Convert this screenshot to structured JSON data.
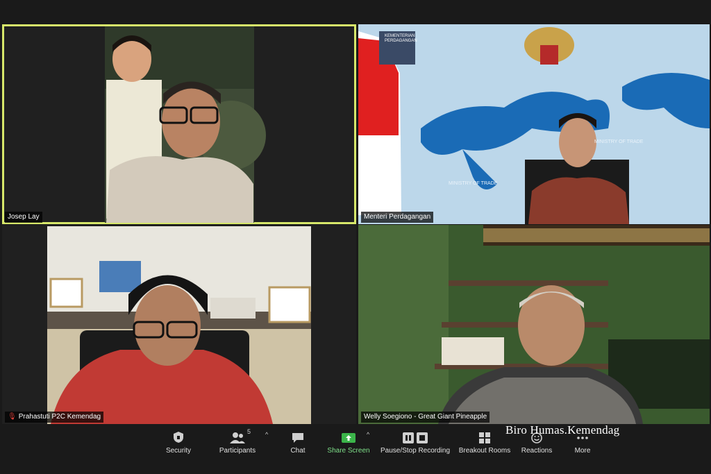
{
  "participants": [
    {
      "name": "Josep Lay",
      "active": true,
      "muted": false
    },
    {
      "name": "Menteri Perdagangan",
      "active": false,
      "muted": false
    },
    {
      "name": "Prahastuti P2C Kemendag",
      "active": false,
      "muted": true
    },
    {
      "name": "Welly Soegiono - Great Giant Pineapple",
      "active": false,
      "muted": false
    }
  ],
  "backdrop": {
    "ministry_text": "KEMENTERIAN PERDAGANGAN",
    "ministry_sub": "REPUBLIK INDONESIA",
    "trade_text": "MINISTRY OF TRADE"
  },
  "toolbar": {
    "security": "Security",
    "participants": "Participants",
    "participants_count": "5",
    "chat": "Chat",
    "share_screen": "Share Screen",
    "recording": "Pause/Stop Recording",
    "breakout": "Breakout Rooms",
    "reactions": "Reactions",
    "more": "More"
  },
  "watermark": "Biro Humas.Kemendag",
  "colors": {
    "active_border": "#d7e86a",
    "share_green": "#3bb54a",
    "mute_red": "#e3413a"
  }
}
